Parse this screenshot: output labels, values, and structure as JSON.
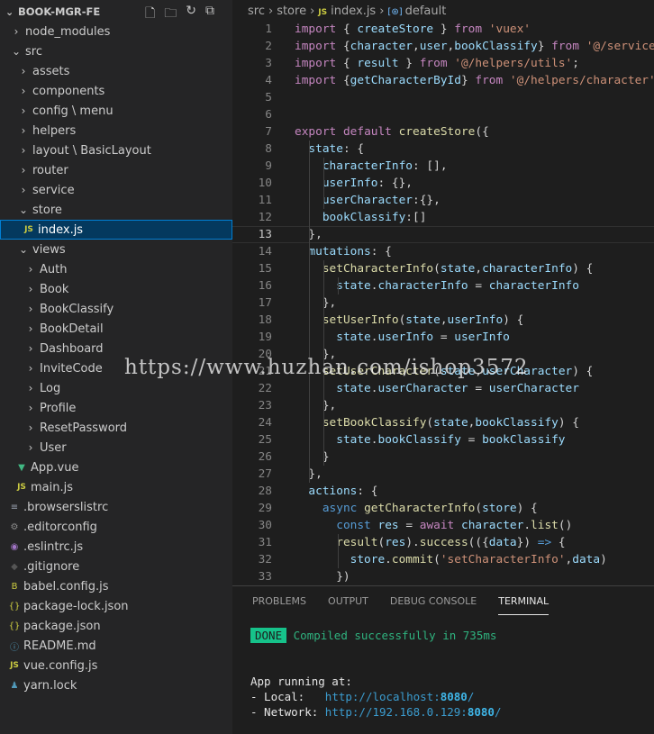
{
  "explorer": {
    "title": "BOOK-MGR-FE",
    "actions": [
      {
        "icon": "new-file-icon",
        "glyph": "🗋"
      },
      {
        "icon": "new-folder-icon",
        "glyph": "🗀"
      },
      {
        "icon": "refresh-icon",
        "glyph": "↻"
      },
      {
        "icon": "collapse-all-icon",
        "glyph": "⧉"
      }
    ],
    "items": [
      {
        "label": "node_modules",
        "type": "folder",
        "open": false,
        "depth": 0
      },
      {
        "label": "src",
        "type": "folder",
        "open": true,
        "depth": 0
      },
      {
        "label": "assets",
        "type": "folder",
        "open": false,
        "depth": 1
      },
      {
        "label": "components",
        "type": "folder",
        "open": false,
        "depth": 1
      },
      {
        "label": "config \\ menu",
        "type": "folder",
        "open": false,
        "depth": 1
      },
      {
        "label": "helpers",
        "type": "folder",
        "open": false,
        "depth": 1
      },
      {
        "label": "layout \\ BasicLayout",
        "type": "folder",
        "open": false,
        "depth": 1
      },
      {
        "label": "router",
        "type": "folder",
        "open": false,
        "depth": 1
      },
      {
        "label": "service",
        "type": "folder",
        "open": false,
        "depth": 1
      },
      {
        "label": "store",
        "type": "folder",
        "open": true,
        "depth": 1
      },
      {
        "label": "index.js",
        "type": "js",
        "depth": 2,
        "selected": true
      },
      {
        "label": "views",
        "type": "folder",
        "open": true,
        "depth": 1
      },
      {
        "label": "Auth",
        "type": "folder",
        "open": false,
        "depth": 2
      },
      {
        "label": "Book",
        "type": "folder",
        "open": false,
        "depth": 2
      },
      {
        "label": "BookClassify",
        "type": "folder",
        "open": false,
        "depth": 2
      },
      {
        "label": "BookDetail",
        "type": "folder",
        "open": false,
        "depth": 2
      },
      {
        "label": "Dashboard",
        "type": "folder",
        "open": false,
        "depth": 2
      },
      {
        "label": "InviteCode",
        "type": "folder",
        "open": false,
        "depth": 2
      },
      {
        "label": "Log",
        "type": "folder",
        "open": false,
        "depth": 2
      },
      {
        "label": "Profile",
        "type": "folder",
        "open": false,
        "depth": 2
      },
      {
        "label": "ResetPassword",
        "type": "folder",
        "open": false,
        "depth": 2
      },
      {
        "label": "User",
        "type": "folder",
        "open": false,
        "depth": 2
      },
      {
        "label": "App.vue",
        "type": "vue",
        "depth": 1
      },
      {
        "label": "main.js",
        "type": "js",
        "depth": 1
      },
      {
        "label": ".browserslistrc",
        "type": "lines",
        "depth": 0
      },
      {
        "label": ".editorconfig",
        "type": "gear",
        "depth": 0
      },
      {
        "label": ".eslintrc.js",
        "type": "eslint",
        "depth": 0
      },
      {
        "label": ".gitignore",
        "type": "git",
        "depth": 0
      },
      {
        "label": "babel.config.js",
        "type": "babel",
        "depth": 0
      },
      {
        "label": "package-lock.json",
        "type": "json",
        "depth": 0
      },
      {
        "label": "package.json",
        "type": "json",
        "depth": 0
      },
      {
        "label": "README.md",
        "type": "info",
        "depth": 0
      },
      {
        "label": "vue.config.js",
        "type": "js",
        "depth": 0
      },
      {
        "label": "yarn.lock",
        "type": "yarn",
        "depth": 0
      }
    ]
  },
  "breadcrumb": [
    "src",
    "store",
    "index.js",
    "default"
  ],
  "editor": {
    "current_line": 13,
    "lines": [
      [
        [
          "k",
          "import"
        ],
        [
          "p",
          " { "
        ],
        [
          "v",
          "createStore"
        ],
        [
          "p",
          " } "
        ],
        [
          "k",
          "from"
        ],
        [
          "p",
          " "
        ],
        [
          "s",
          "'vuex'"
        ]
      ],
      [
        [
          "k",
          "import"
        ],
        [
          "p",
          " {"
        ],
        [
          "v",
          "character"
        ],
        [
          "p",
          ","
        ],
        [
          "v",
          "user"
        ],
        [
          "p",
          ","
        ],
        [
          "v",
          "bookClassify"
        ],
        [
          "p",
          "} "
        ],
        [
          "k",
          "from"
        ],
        [
          "p",
          " "
        ],
        [
          "s",
          "'@/service"
        ]
      ],
      [
        [
          "k",
          "import"
        ],
        [
          "p",
          " { "
        ],
        [
          "v",
          "result"
        ],
        [
          "p",
          " } "
        ],
        [
          "k",
          "from"
        ],
        [
          "p",
          " "
        ],
        [
          "s",
          "'@/helpers/utils'"
        ],
        [
          "p",
          ";"
        ]
      ],
      [
        [
          "k",
          "import"
        ],
        [
          "p",
          " {"
        ],
        [
          "v",
          "getCharacterById"
        ],
        [
          "p",
          "} "
        ],
        [
          "k",
          "from"
        ],
        [
          "p",
          " "
        ],
        [
          "s",
          "'@/helpers/character'"
        ]
      ],
      [],
      [],
      [
        [
          "k",
          "export"
        ],
        [
          "p",
          " "
        ],
        [
          "k",
          "default"
        ],
        [
          "p",
          " "
        ],
        [
          "f",
          "createStore"
        ],
        [
          "p",
          "({"
        ]
      ],
      [
        [
          "p",
          "  "
        ],
        [
          "v",
          "state"
        ],
        [
          "p",
          ": {"
        ]
      ],
      [
        [
          "p",
          "    "
        ],
        [
          "v",
          "characterInfo"
        ],
        [
          "p",
          ": [],"
        ]
      ],
      [
        [
          "p",
          "    "
        ],
        [
          "v",
          "userInfo"
        ],
        [
          "p",
          ": {},"
        ]
      ],
      [
        [
          "p",
          "    "
        ],
        [
          "v",
          "userCharacter"
        ],
        [
          "p",
          ":{},"
        ]
      ],
      [
        [
          "p",
          "    "
        ],
        [
          "v",
          "bookClassify"
        ],
        [
          "p",
          ":[]"
        ]
      ],
      [
        [
          "p",
          "  },"
        ]
      ],
      [
        [
          "p",
          "  "
        ],
        [
          "v",
          "mutations"
        ],
        [
          "p",
          ": {"
        ]
      ],
      [
        [
          "p",
          "    "
        ],
        [
          "f",
          "setCharacterInfo"
        ],
        [
          "p",
          "("
        ],
        [
          "v",
          "state"
        ],
        [
          "p",
          ","
        ],
        [
          "v",
          "characterInfo"
        ],
        [
          "p",
          ") {"
        ]
      ],
      [
        [
          "p",
          "      "
        ],
        [
          "v",
          "state"
        ],
        [
          "p",
          "."
        ],
        [
          "v",
          "characterInfo"
        ],
        [
          "p",
          " = "
        ],
        [
          "v",
          "characterInfo"
        ]
      ],
      [
        [
          "p",
          "    },"
        ]
      ],
      [
        [
          "p",
          "    "
        ],
        [
          "f",
          "setUserInfo"
        ],
        [
          "p",
          "("
        ],
        [
          "v",
          "state"
        ],
        [
          "p",
          ","
        ],
        [
          "v",
          "userInfo"
        ],
        [
          "p",
          ") {"
        ]
      ],
      [
        [
          "p",
          "      "
        ],
        [
          "v",
          "state"
        ],
        [
          "p",
          "."
        ],
        [
          "v",
          "userInfo"
        ],
        [
          "p",
          " = "
        ],
        [
          "v",
          "userInfo"
        ]
      ],
      [
        [
          "p",
          "    },"
        ]
      ],
      [
        [
          "p",
          "    "
        ],
        [
          "f",
          "setUserCharacter"
        ],
        [
          "p",
          "("
        ],
        [
          "v",
          "state"
        ],
        [
          "p",
          ","
        ],
        [
          "v",
          "userCharacter"
        ],
        [
          "p",
          ") {"
        ]
      ],
      [
        [
          "p",
          "      "
        ],
        [
          "v",
          "state"
        ],
        [
          "p",
          "."
        ],
        [
          "v",
          "userCharacter"
        ],
        [
          "p",
          " = "
        ],
        [
          "v",
          "userCharacter"
        ]
      ],
      [
        [
          "p",
          "    },"
        ]
      ],
      [
        [
          "p",
          "    "
        ],
        [
          "f",
          "setBookClassify"
        ],
        [
          "p",
          "("
        ],
        [
          "v",
          "state"
        ],
        [
          "p",
          ","
        ],
        [
          "v",
          "bookClassify"
        ],
        [
          "p",
          ") {"
        ]
      ],
      [
        [
          "p",
          "      "
        ],
        [
          "v",
          "state"
        ],
        [
          "p",
          "."
        ],
        [
          "v",
          "bookClassify"
        ],
        [
          "p",
          " = "
        ],
        [
          "v",
          "bookClassify"
        ]
      ],
      [
        [
          "p",
          "    }"
        ]
      ],
      [
        [
          "p",
          "  },"
        ]
      ],
      [
        [
          "p",
          "  "
        ],
        [
          "v",
          "actions"
        ],
        [
          "p",
          ": {"
        ]
      ],
      [
        [
          "p",
          "    "
        ],
        [
          "b",
          "async"
        ],
        [
          "p",
          " "
        ],
        [
          "f",
          "getCharacterInfo"
        ],
        [
          "p",
          "("
        ],
        [
          "v",
          "store"
        ],
        [
          "p",
          ") {"
        ]
      ],
      [
        [
          "p",
          "      "
        ],
        [
          "b",
          "const"
        ],
        [
          "p",
          " "
        ],
        [
          "v",
          "res"
        ],
        [
          "p",
          " = "
        ],
        [
          "k",
          "await"
        ],
        [
          "p",
          " "
        ],
        [
          "v",
          "character"
        ],
        [
          "p",
          "."
        ],
        [
          "f",
          "list"
        ],
        [
          "p",
          "()"
        ]
      ],
      [
        [
          "p",
          "      "
        ],
        [
          "f",
          "result"
        ],
        [
          "p",
          "("
        ],
        [
          "v",
          "res"
        ],
        [
          "p",
          ")."
        ],
        [
          "f",
          "success"
        ],
        [
          "p",
          "(({"
        ],
        [
          "v",
          "data"
        ],
        [
          "p",
          "}) "
        ],
        [
          "b",
          "=>"
        ],
        [
          "p",
          " {"
        ]
      ],
      [
        [
          "p",
          "        "
        ],
        [
          "v",
          "store"
        ],
        [
          "p",
          "."
        ],
        [
          "f",
          "commit"
        ],
        [
          "p",
          "("
        ],
        [
          "s",
          "'setCharacterInfo'"
        ],
        [
          "p",
          ","
        ],
        [
          "v",
          "data"
        ],
        [
          "p",
          ")"
        ]
      ],
      [
        [
          "p",
          "      })"
        ]
      ]
    ]
  },
  "watermark": "https://www.huzhan.com/ishop3572",
  "panel": {
    "tabs": [
      "PROBLEMS",
      "OUTPUT",
      "DEBUG CONSOLE",
      "TERMINAL"
    ],
    "active_tab": "TERMINAL",
    "terminal": {
      "badge": "DONE",
      "compiled": "Compiled successfully in 735ms",
      "running": "App running at:",
      "local_label": "- Local:   ",
      "local_url_prefix": "http://localhost:",
      "local_port": "8080",
      "network_label": "- Network: ",
      "network_url_prefix": "http://192.168.0.129:",
      "network_port": "8080",
      "url_suffix": "/"
    }
  }
}
